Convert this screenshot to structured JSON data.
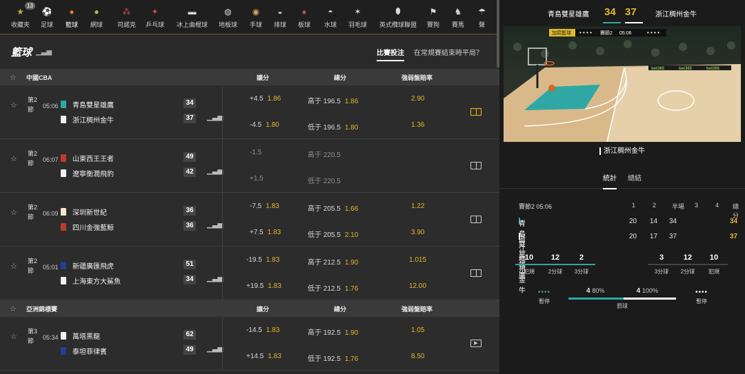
{
  "sports_nav": [
    {
      "label": "收藏夾",
      "icon": "star-icon",
      "badge": "13"
    },
    {
      "label": "足球",
      "icon": "soccer-icon"
    },
    {
      "label": "籃球",
      "icon": "basketball-icon",
      "active": true
    },
    {
      "label": "網球",
      "icon": "tennis-icon"
    },
    {
      "label": "司諾克",
      "icon": "snooker-icon"
    },
    {
      "label": "乒乓球",
      "icon": "table-tennis-icon"
    },
    {
      "label": "冰上曲棍球",
      "icon": "ice-hockey-icon"
    },
    {
      "label": "地板球",
      "icon": "floorball-icon"
    },
    {
      "label": "手球",
      "icon": "handball-icon"
    },
    {
      "label": "排球",
      "icon": "volleyball-icon"
    },
    {
      "label": "板球",
      "icon": "cricket-icon"
    },
    {
      "label": "水球",
      "icon": "water-polo-icon"
    },
    {
      "label": "羽毛球",
      "icon": "badminton-icon"
    },
    {
      "label": "英式欖球聯盟",
      "icon": "rugby-icon"
    },
    {
      "label": "賽狗",
      "icon": "greyhound-icon"
    },
    {
      "label": "賽馬",
      "icon": "horse-racing-icon"
    },
    {
      "label": "聲",
      "icon": "more-icon"
    }
  ],
  "header": {
    "title": "籃球",
    "tab_inplay": "比賽投注",
    "tab_question": "在常規賽結束時平局？"
  },
  "col_headers": {
    "handicap": "讓分",
    "total": "總分",
    "moneyline": "強弱盤賠率"
  },
  "leagues": [
    {
      "name": "中國CBA",
      "matches": [
        {
          "period": "第2節",
          "clock": "05:06",
          "home": "青島雙星雄鷹",
          "away": "浙江稠州金牛",
          "home_score": "34",
          "away_score": "37",
          "hcp": [
            {
              "label": "+4.5",
              "odd": "1.86"
            },
            {
              "label": "-4.5",
              "odd": "1.80"
            }
          ],
          "tot": [
            {
              "label": "高于 196.5",
              "odd": "1.86"
            },
            {
              "label": "低于 196.5",
              "odd": "1.80"
            }
          ],
          "ml": [
            "2.90",
            "1.36"
          ],
          "live": true,
          "home_color": "#2fa8a5",
          "away_color": "#f2f2f2"
        },
        {
          "period": "第2節",
          "clock": "06:07",
          "home": "山東西王王者",
          "away": "遼寧衡潤飛豹",
          "home_score": "49",
          "away_score": "42",
          "hcp": [
            {
              "label": "-1.5",
              "odd": ""
            },
            {
              "label": "+1.5",
              "odd": ""
            }
          ],
          "tot": [
            {
              "label": "高于 220.5",
              "odd": ""
            },
            {
              "label": "低于 220.5",
              "odd": ""
            }
          ],
          "ml": [
            "",
            ""
          ],
          "suspended": true,
          "home_color": "#c0392b",
          "away_color": "#f2f2f2"
        },
        {
          "period": "第2節",
          "clock": "06:09",
          "home": "深圳新世紀",
          "away": "四川金強藍鯨",
          "home_score": "36",
          "away_score": "36",
          "hcp": [
            {
              "label": "-7.5",
              "odd": "1.83"
            },
            {
              "label": "+7.5",
              "odd": "1.83"
            }
          ],
          "tot": [
            {
              "label": "高于 205.5",
              "odd": "1.66"
            },
            {
              "label": "低于 205.5",
              "odd": "2.10"
            }
          ],
          "ml": [
            "1.22",
            "3.90"
          ],
          "home_color": "#f2e9d0",
          "away_color": "#c0392b"
        },
        {
          "period": "第2節",
          "clock": "05:01",
          "home": "新疆廣匯飛虎",
          "away": "上海東方大鯊魚",
          "home_score": "51",
          "away_score": "34",
          "hcp": [
            {
              "label": "-19.5",
              "odd": "1.83"
            },
            {
              "label": "+19.5",
              "odd": "1.83"
            }
          ],
          "tot": [
            {
              "label": "高于 212.5",
              "odd": "1.90"
            },
            {
              "label": "低于 212.5",
              "odd": "1.76"
            }
          ],
          "ml": [
            "1.015",
            "12.00"
          ],
          "home_color": "#1f3f9a",
          "away_color": "#f2f2f2"
        }
      ]
    },
    {
      "name": "亞洲錦標賽",
      "matches": [
        {
          "period": "第3節",
          "clock": "05:34",
          "home": "萬塔黑龍",
          "away": "泰坦菲律賓",
          "home_score": "62",
          "away_score": "49",
          "hcp": [
            {
              "label": "-14.5",
              "odd": "1.83"
            },
            {
              "label": "+14.5",
              "odd": "1.83"
            }
          ],
          "tot": [
            {
              "label": "高于 192.5",
              "odd": "1.90"
            },
            {
              "label": "低于 192.5",
              "odd": "1.76"
            }
          ],
          "ml": [
            "1.05",
            "8.50"
          ],
          "video": true,
          "home_color": "#f2f2f2",
          "away_color": "#1f3f9a"
        }
      ]
    }
  ],
  "right": {
    "home": "青島雙星雄鷹",
    "away": "浙江稠州金牛",
    "home_score": "34",
    "away_score": "37",
    "court_badge": "加罰籃球",
    "court_period": "賽節2",
    "court_clock": "05:06",
    "court_banner": "bet365",
    "court_team_label": "浙江稠州金牛",
    "tab_stats": "統計",
    "tab_summary": "總結",
    "sb_header": {
      "period": "賽節2",
      "clock": "05:06",
      "cols": [
        "1",
        "2",
        "半場",
        "3",
        "4",
        "總分"
      ]
    },
    "sb_rows": [
      {
        "team": "青島雙星雄鷹",
        "vals": [
          "20",
          "14",
          "34",
          "",
          "",
          "34"
        ],
        "color": "#2fa8a5"
      },
      {
        "team": "浙江稠州金牛",
        "vals": [
          "20",
          "17",
          "37",
          "",
          "",
          "37"
        ],
        "color": "#ffffff"
      }
    ],
    "home_stats": [
      {
        "v": "10",
        "l": "犯規"
      },
      {
        "v": "12",
        "l": "2分球"
      },
      {
        "v": "2",
        "l": "3分球"
      }
    ],
    "away_stats": [
      {
        "v": "3",
        "l": "3分球"
      },
      {
        "v": "12",
        "l": "2分球"
      },
      {
        "v": "10",
        "l": "犯規"
      }
    ],
    "timeout_label": "暫停",
    "ft_home": "4",
    "ft_home_pct": "80%",
    "ft_away": "4",
    "ft_away_pct": "100%",
    "ft_label": "罰球",
    "colors": {
      "home": "#2fa8a5",
      "away": "#ffffff",
      "accent": "#e3b82b"
    }
  }
}
